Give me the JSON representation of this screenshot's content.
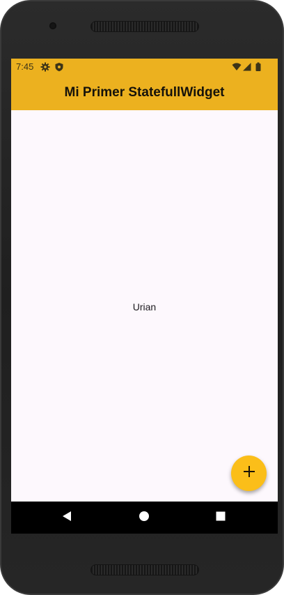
{
  "status_bar": {
    "time": "7:45",
    "icons": [
      "gear-icon",
      "shield-icon",
      "wifi-icon",
      "signal-icon",
      "battery-icon"
    ]
  },
  "app_bar": {
    "title": "Mi Primer StatefullWidget",
    "background_color": "#ecb11f"
  },
  "body": {
    "text": "Urian",
    "background_color": "#fdf8fd"
  },
  "fab": {
    "icon": "plus-icon",
    "color": "#fbbe19"
  },
  "navigation": {
    "buttons": [
      "back-icon",
      "home-icon",
      "recents-icon"
    ]
  }
}
